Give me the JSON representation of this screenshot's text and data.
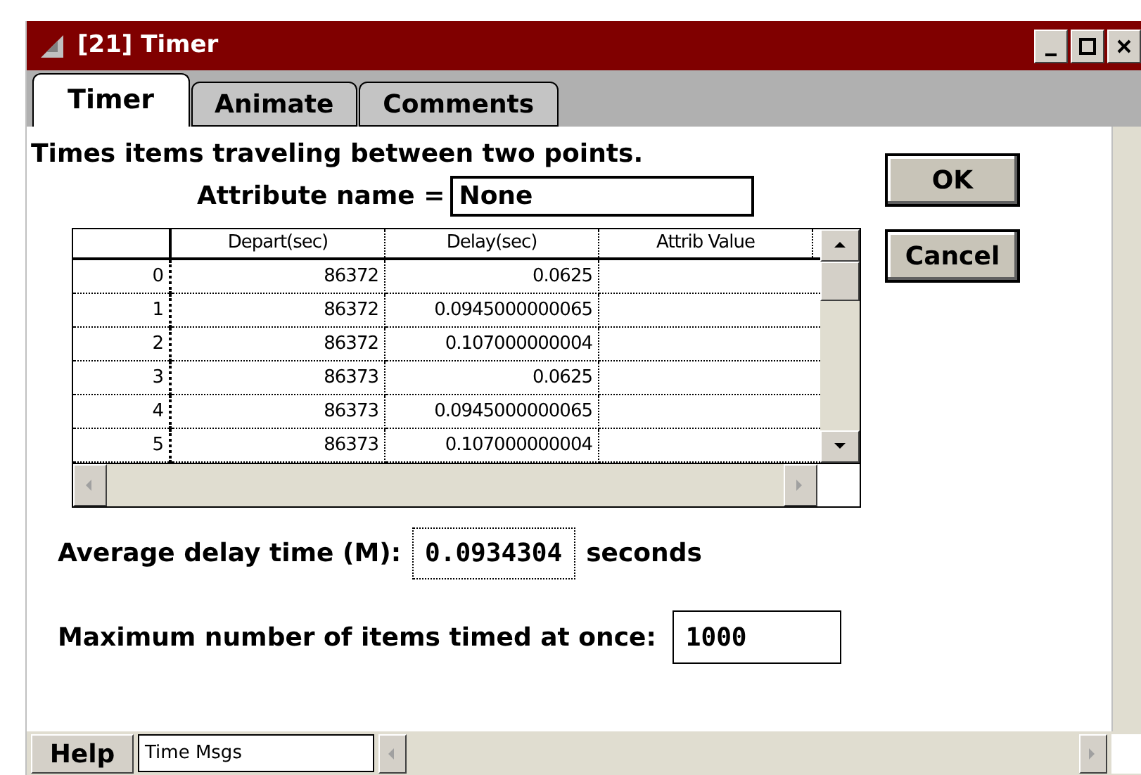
{
  "window": {
    "title": "[21]  Timer"
  },
  "tabs": [
    {
      "label": "Timer",
      "selected": true
    },
    {
      "label": "Animate",
      "selected": false
    },
    {
      "label": "Comments",
      "selected": false
    }
  ],
  "description": "Times items traveling between two points.",
  "attribute": {
    "label": "Attribute name =",
    "value": "None"
  },
  "buttons": [
    "OK",
    "Cancel"
  ],
  "table": {
    "columns": [
      "Depart(sec)",
      "Delay(sec)",
      "Attrib Value"
    ],
    "rows": [
      {
        "index": "0",
        "depart": "86372",
        "delay": "0.0625"
      },
      {
        "index": "1",
        "depart": "86372",
        "delay": "0.0945000000065"
      },
      {
        "index": "2",
        "depart": "86372",
        "delay": "0.107000000004"
      },
      {
        "index": "3",
        "depart": "86373",
        "delay": "0.0625"
      },
      {
        "index": "4",
        "depart": "86373",
        "delay": "0.0945000000065"
      },
      {
        "index": "5",
        "depart": "86373",
        "delay": "0.107000000004"
      }
    ]
  },
  "average": {
    "label": "Average delay time (M):",
    "value": "0.0934304",
    "unit": "seconds"
  },
  "maximum": {
    "label": "Maximum number of items timed at once:",
    "value": "1000"
  },
  "footer": {
    "help": "Help",
    "field": "Time Msgs"
  }
}
